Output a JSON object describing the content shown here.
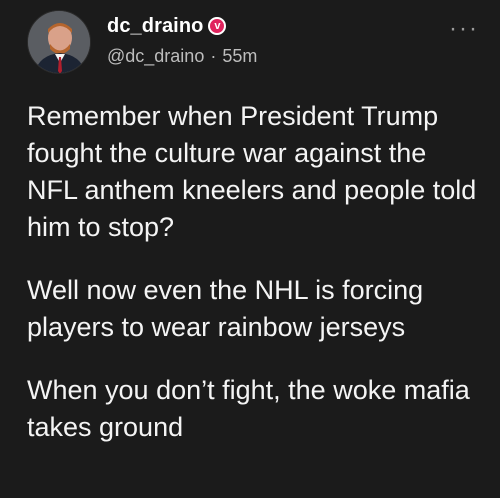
{
  "author": {
    "display_name": "dc_draino",
    "handle": "@dc_draino",
    "separator": "·",
    "time": "55m",
    "verified_icon": "verified-badge-icon"
  },
  "menu": {
    "icon": "more-options-icon",
    "glyph": "···"
  },
  "post": {
    "paragraphs": [
      "Remember when President Trump fought the culture war against the NFL anthem kneelers and people told him to stop?",
      "Well now even the NHL is forcing players to wear rainbow jerseys",
      "When you don’t fight, the woke mafia takes ground"
    ]
  },
  "colors": {
    "background": "#1b1b1b",
    "text": "#f4f4f4",
    "muted": "#bdbdbd",
    "badge": "#e0245e"
  }
}
